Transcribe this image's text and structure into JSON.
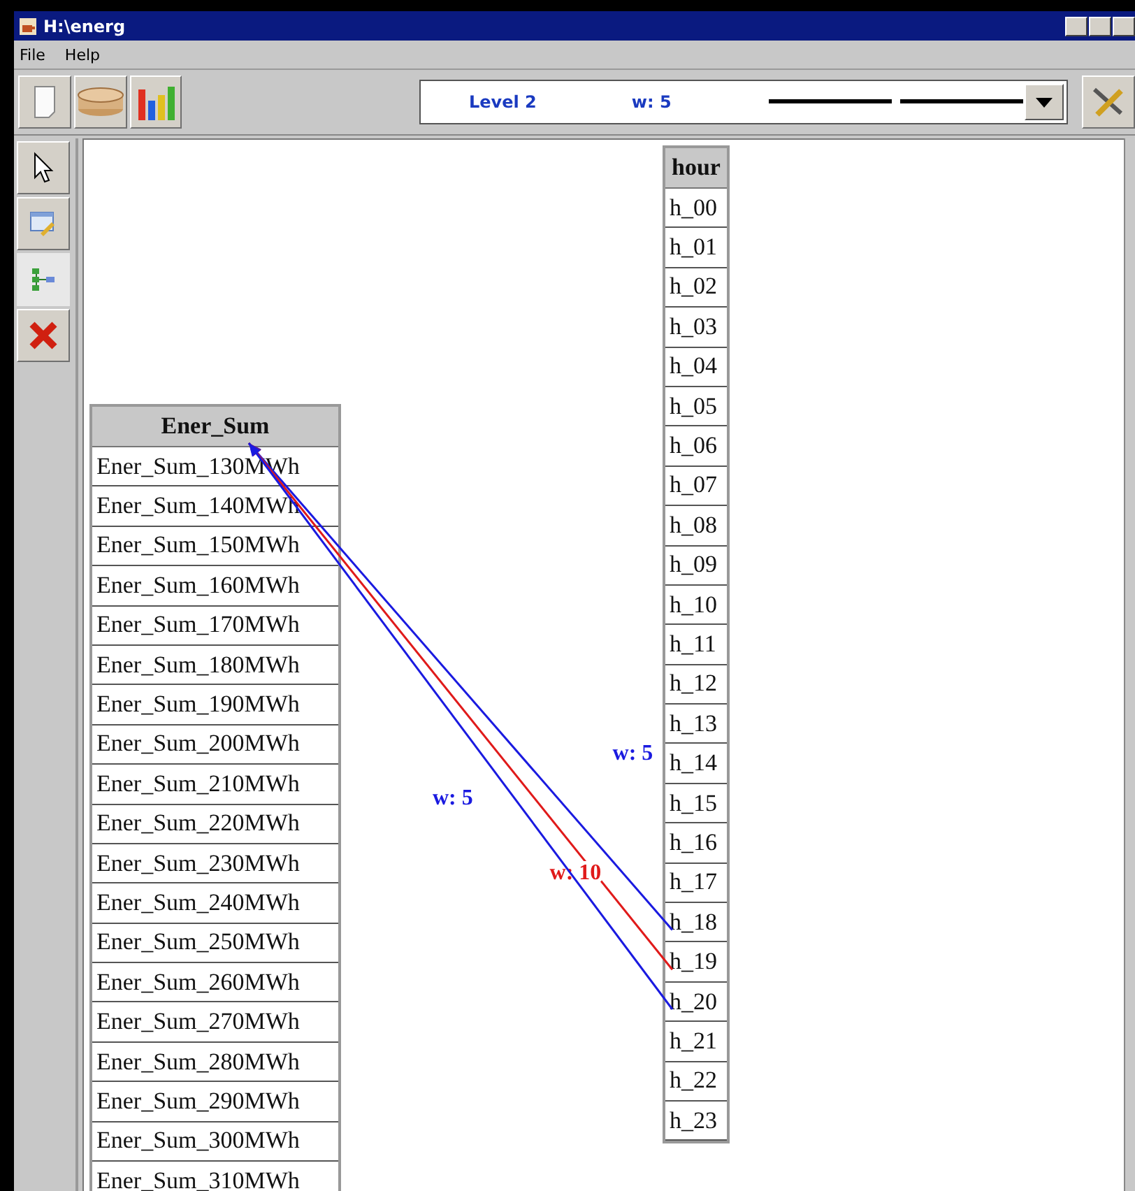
{
  "window": {
    "title": "H:\\energ"
  },
  "menu": [
    "File",
    "Help"
  ],
  "level_selector": {
    "level": "Level 2",
    "weight": "w: 5"
  },
  "tools": [
    {
      "kind": "pointer",
      "selected": false
    },
    {
      "kind": "edit",
      "selected": false
    },
    {
      "kind": "tree",
      "selected": true
    },
    {
      "kind": "delete",
      "selected": false
    }
  ],
  "tables": [
    {
      "title": "Ener_Sum",
      "rows": [
        "Ener_Sum_130MWh",
        "Ener_Sum_140MWh",
        "Ener_Sum_150MWh",
        "Ener_Sum_160MWh",
        "Ener_Sum_170MWh",
        "Ener_Sum_180MWh",
        "Ener_Sum_190MWh",
        "Ener_Sum_200MWh",
        "Ener_Sum_210MWh",
        "Ener_Sum_220MWh",
        "Ener_Sum_230MWh",
        "Ener_Sum_240MWh",
        "Ener_Sum_250MWh",
        "Ener_Sum_260MWh",
        "Ener_Sum_270MWh",
        "Ener_Sum_280MWh",
        "Ener_Sum_290MWh",
        "Ener_Sum_300MWh",
        "Ener_Sum_310MWh"
      ]
    },
    {
      "title": "hour",
      "rows": [
        "h_00",
        "h_01",
        "h_02",
        "h_03",
        "h_04",
        "h_05",
        "h_06",
        "h_07",
        "h_08",
        "h_09",
        "h_10",
        "h_11",
        "h_12",
        "h_13",
        "h_14",
        "h_15",
        "h_16",
        "h_17",
        {
          "text": "h_18",
          "link": {
            "label": "w: 5",
            "color": "#1a1ae0"
          }
        },
        {
          "text": "h_19",
          "link": {
            "label": "w: 10",
            "color": "#e01a1a"
          }
        },
        {
          "text": "h_20",
          "link": {
            "label": "w: 5",
            "color": "#1a1ae0"
          }
        },
        "h_21",
        "h_22",
        "h_23"
      ]
    }
  ]
}
